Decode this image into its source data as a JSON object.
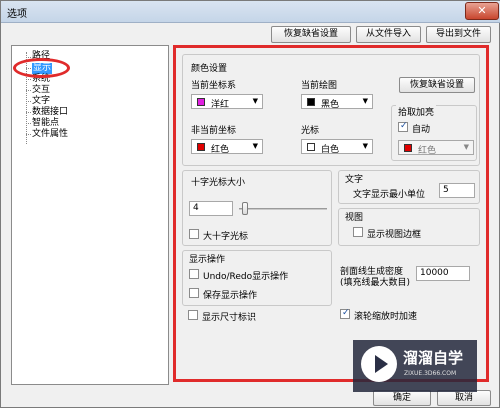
{
  "window": {
    "title": "选项",
    "close_label": "✕"
  },
  "top_buttons": {
    "restore_defaults": "恢复缺省设置",
    "import_file": "从文件导入",
    "export_file": "导出到文件"
  },
  "tree": {
    "items": [
      "路径",
      "显示",
      "系统",
      "交互",
      "文字",
      "数据接口",
      "智能点",
      "文件属性"
    ],
    "selected": "显示"
  },
  "colors": {
    "group_title": "颜色设置",
    "current_axis_label": "当前坐标系",
    "current_axis_value": "洋红",
    "current_axis_color": "#e020e0",
    "current_draw_label": "当前绘图",
    "current_draw_value": "黑色",
    "current_draw_color": "#000000",
    "restore_defaults": "恢复缺省设置",
    "noncurrent_axis_label": "非当前坐标",
    "noncurrent_axis_value": "红色",
    "noncurrent_axis_color": "#e00000",
    "cursor_label": "光标",
    "cursor_value": "白色",
    "cursor_color": "#ffffff",
    "pick_highlight": {
      "title": "拾取加亮",
      "auto_label": "自动",
      "auto_checked": true,
      "value": "红色",
      "color": "#e00000"
    }
  },
  "crosshair": {
    "title": "十字光标大小",
    "value": "4",
    "slider_fraction": 0.04,
    "big_label": "大十字光标"
  },
  "text": {
    "title": "文字",
    "min_unit_label": "文字显示最小单位",
    "min_unit_value": "5"
  },
  "view": {
    "title": "视图",
    "show_border_label": "显示视图边框"
  },
  "display_ops": {
    "title": "显示操作",
    "undo_redo_label": "Undo/Redo显示操作",
    "save_display_label": "保存显示操作"
  },
  "section_density": {
    "label_line1": "剖面线生成密度",
    "label_line2": "(填充线最大数目)",
    "value": "10000"
  },
  "dim_marks": {
    "label": "显示尺寸标识"
  },
  "wheel_zoom": {
    "label": "滚轮缩放时加速",
    "checked": true
  },
  "bottom_buttons": {
    "ok": "确定",
    "cancel": "取消"
  },
  "watermark": {
    "main": "溜溜自学",
    "sub": "ZIXUE.3D66.COM"
  }
}
